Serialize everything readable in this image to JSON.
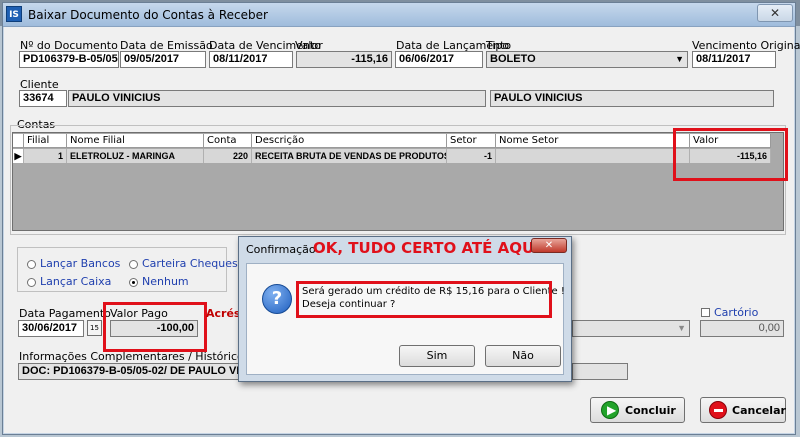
{
  "window": {
    "title": "Baixar Documento do Contas à Receber",
    "app_icon_text": "IS",
    "close_symbol": "✕"
  },
  "documento": {
    "num_label": "Nº do Documento",
    "num_value": "PD106379-B-05/05",
    "emissao_label": "Data de Emissão",
    "emissao_value": "09/05/2017",
    "vencimento_label": "Data de Vencimento",
    "vencimento_value": "08/11/2017",
    "valor_label": "Valor",
    "valor_value": "-115,16",
    "lancamento_label": "Data de Lançamento",
    "lancamento_value": "06/06/2017",
    "tipo_label": "Tipo",
    "tipo_value": "BOLETO",
    "venc_original_label": "Vencimento Original",
    "venc_original_value": "08/11/2017"
  },
  "cliente": {
    "label": "Cliente",
    "code": "33674",
    "name": "PAULO VINICIUS",
    "name2": "PAULO VINICIUS"
  },
  "contas": {
    "group_label": "Contas",
    "columns": [
      "Filial",
      "Nome Filial",
      "Conta",
      "Descrição",
      "Setor",
      "Nome Setor",
      "Valor"
    ],
    "row": {
      "filial": "1",
      "nome_filial": "ELETROLUZ - MARINGA",
      "conta": "220",
      "descricao": "RECEITA BRUTA DE VENDAS DE PRODUTOS",
      "setor": "-1",
      "nome_setor": "",
      "valor": "-115,16"
    }
  },
  "opcoes": {
    "lancar_bancos": "Lançar Bancos",
    "carteira_cheques": "Carteira Cheques",
    "lancar_caixa": "Lançar Caixa",
    "nenhum": "Nenhum"
  },
  "pagamento": {
    "data_label": "Data Pagamento",
    "data_value": "30/06/2017",
    "cal_icon_text": "15",
    "valor_pago_label": "Valor Pago",
    "valor_pago_value": "-100,00",
    "acrescimo_label_partial": "Acréscir",
    "cartorio_label": "Cartório",
    "cartorio_value": "0,00"
  },
  "info": {
    "label": "Informações Complementares / Histórico",
    "value": "DOC: PD106379-B-05/05-02/ DE PAULO VI"
  },
  "actions": {
    "concluir": "Concluir",
    "cancelar": "Cancelar"
  },
  "dialog": {
    "title": "Confirmação",
    "annotation": "OK, TUDO CERTO ATÉ AQUI",
    "icon_text": "?",
    "line1": "Será gerado um crédito de R$ 15,16 para o Cliente !",
    "line2": "Deseja continuar ?",
    "sim": "Sim",
    "nao": "Não",
    "close_symbol": "✕"
  },
  "colors": {
    "annotation_red": "#e0101a",
    "accent_blue": "#1f3fae"
  }
}
